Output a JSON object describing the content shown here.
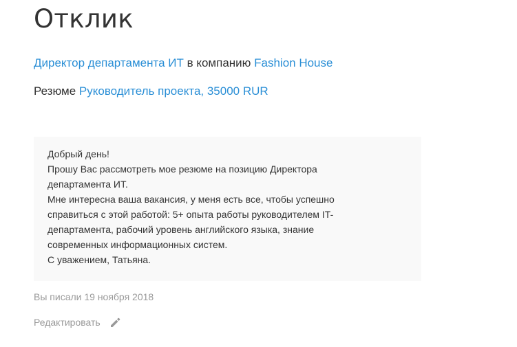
{
  "page": {
    "title": "Отклик"
  },
  "vacancy": {
    "title": "Директор департамента ИТ",
    "connector": " в компанию ",
    "company": "Fashion House"
  },
  "resume": {
    "label": "Резюме ",
    "link": "Руководитель проекта, 35000 RUR"
  },
  "message": {
    "lines": [
      "Добрый день!",
      "Прошу Вас рассмотреть мое резюме на позицию Директора",
      "департамента ИТ.",
      "Мне интересна ваша вакансия, у меня есть все, чтобы успешно",
      "справиться с этой работой: 5+ опыта работы руководителем IT-",
      "департамента, рабочий уровень английского языка, знание",
      "современных информационных систем.",
      "С уважением, Татьяна."
    ]
  },
  "sent": {
    "text": "Вы писали 19 ноября 2018"
  },
  "edit": {
    "label": "Редактировать",
    "icon": "pencil-icon"
  },
  "colors": {
    "link": "#2b8fd6",
    "muted": "#999999",
    "text": "#333333",
    "message_bg": "#f9f9f9"
  }
}
